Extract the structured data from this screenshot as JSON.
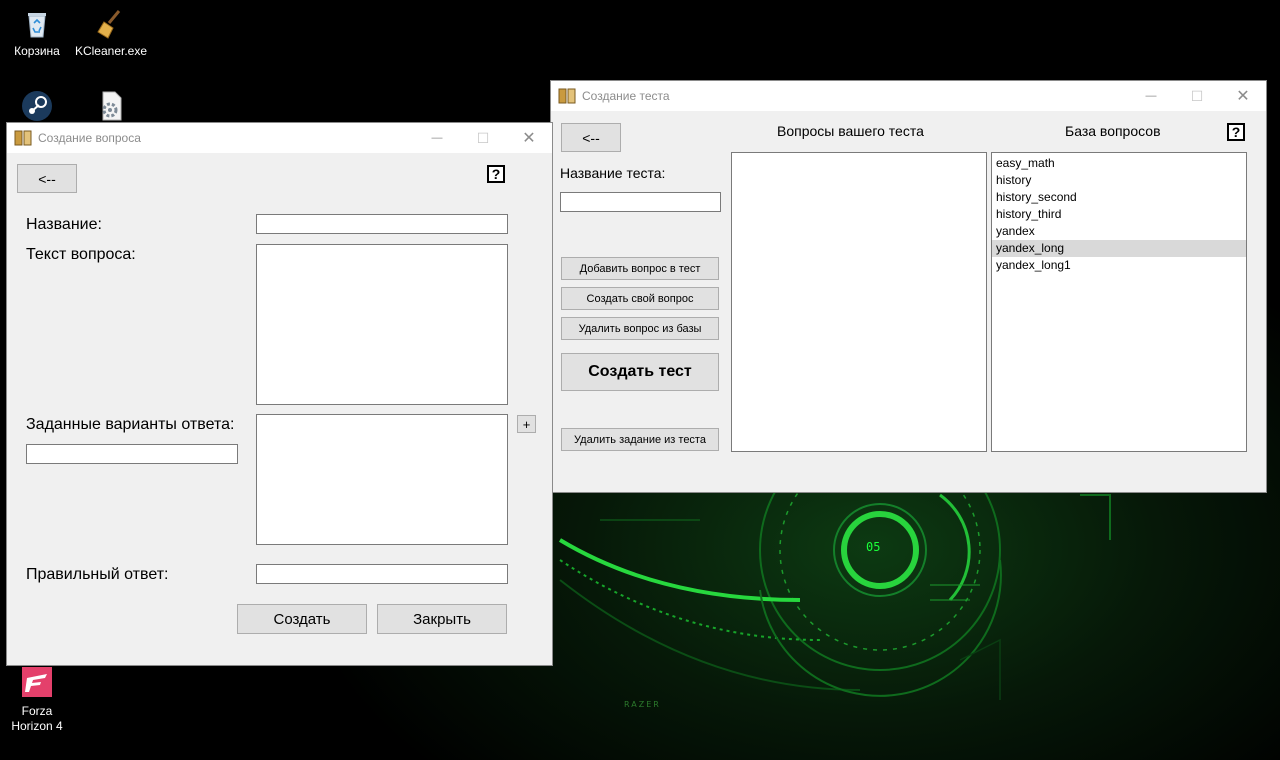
{
  "desktop": {
    "icons": [
      {
        "label": "Корзина"
      },
      {
        "label": "KCleaner.exe"
      },
      {
        "label": "Forza\nHorizon 4"
      }
    ],
    "wallpaper_text": {
      "dial": "05",
      "brand": "RAZER"
    }
  },
  "question_window": {
    "title": "Создание вопроса",
    "back_label": "<--",
    "help_label": "?",
    "name_label": "Название:",
    "name_value": "",
    "text_label": "Текст вопроса:",
    "text_value": "",
    "variants_label": "Заданные варианты ответа:",
    "variant_input_value": "",
    "add_variant_label": "+",
    "correct_label": "Правильный ответ:",
    "correct_value": "",
    "create_label": "Создать",
    "close_label": "Закрыть"
  },
  "test_window": {
    "title": "Создание теста",
    "back_label": "<--",
    "help_label": "?",
    "test_name_label": "Название теста:",
    "test_name_value": "",
    "your_questions_header": "Вопросы вашего теста",
    "base_header": "База вопросов",
    "add_question_label": "Добавить вопрос в тест",
    "create_own_label": "Создать свой вопрос",
    "delete_from_base_label": "Удалить вопрос из базы",
    "create_test_label": "Создать тест",
    "delete_from_test_label": "Удалить задание из теста",
    "your_questions": [],
    "base_questions": [
      "easy_math",
      "history",
      "history_second",
      "history_third",
      "yandex",
      "yandex_long",
      "yandex_long1"
    ],
    "selected_base_question": "yandex_long"
  },
  "window_controls": {
    "minimize": "—",
    "maximize": "☐",
    "close": "✕"
  }
}
